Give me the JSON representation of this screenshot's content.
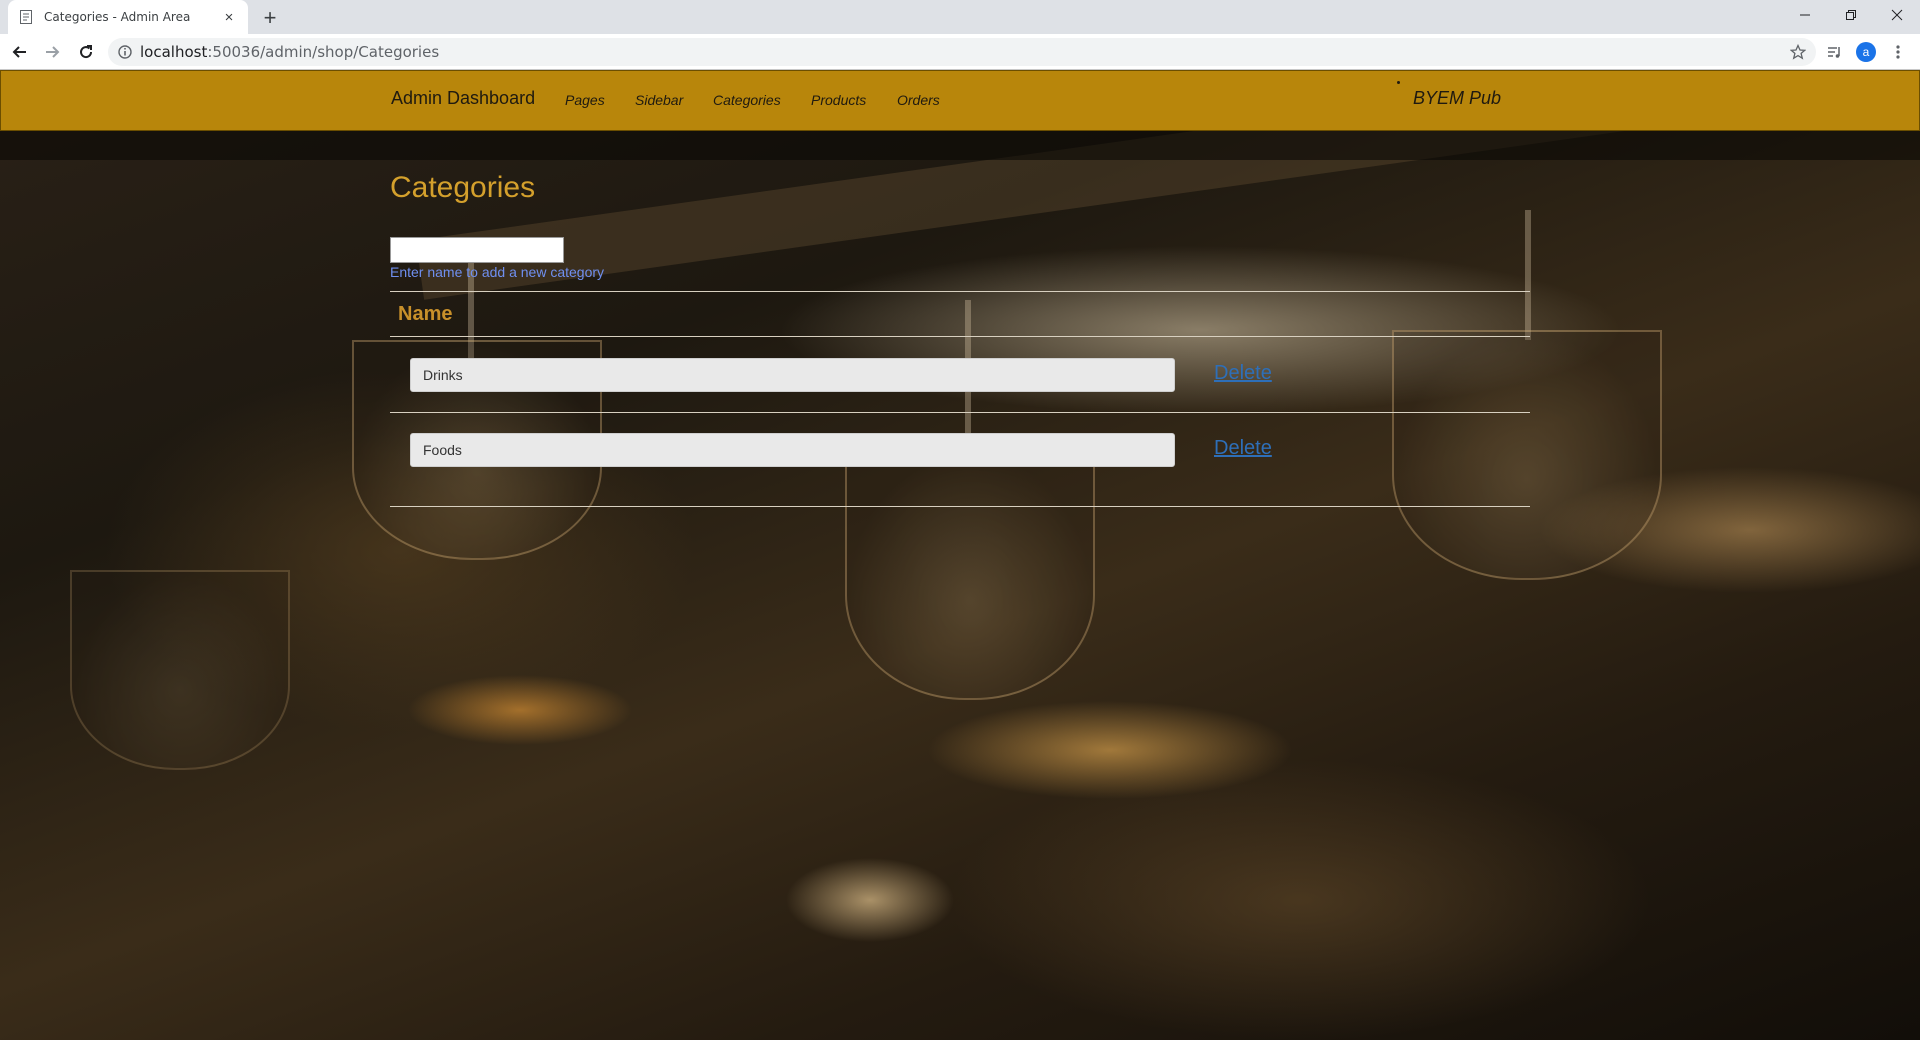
{
  "browser": {
    "tab_title": "Categories - Admin Area",
    "tab_close": "×",
    "new_tab": "+",
    "url_host": "localhost",
    "url_rest": ":50036/admin/shop/Categories",
    "profile_initial": "a"
  },
  "navbar": {
    "brand": "Admin Dashboard",
    "links": [
      "Pages",
      "Sidebar",
      "Categories",
      "Products",
      "Orders"
    ],
    "site_name": "BYEM Pub",
    "background": "#b8860b"
  },
  "main": {
    "title": "Categories",
    "new_category_value": "",
    "new_category_hint": "Enter name to add a new category",
    "table_header": "Name",
    "rows": [
      {
        "name": "Drinks",
        "action": "Delete"
      },
      {
        "name": "Foods",
        "action": "Delete"
      }
    ]
  },
  "colors": {
    "title": "#d4a02c",
    "hint": "#6f8ff0",
    "delete": "#2e6fb8"
  }
}
